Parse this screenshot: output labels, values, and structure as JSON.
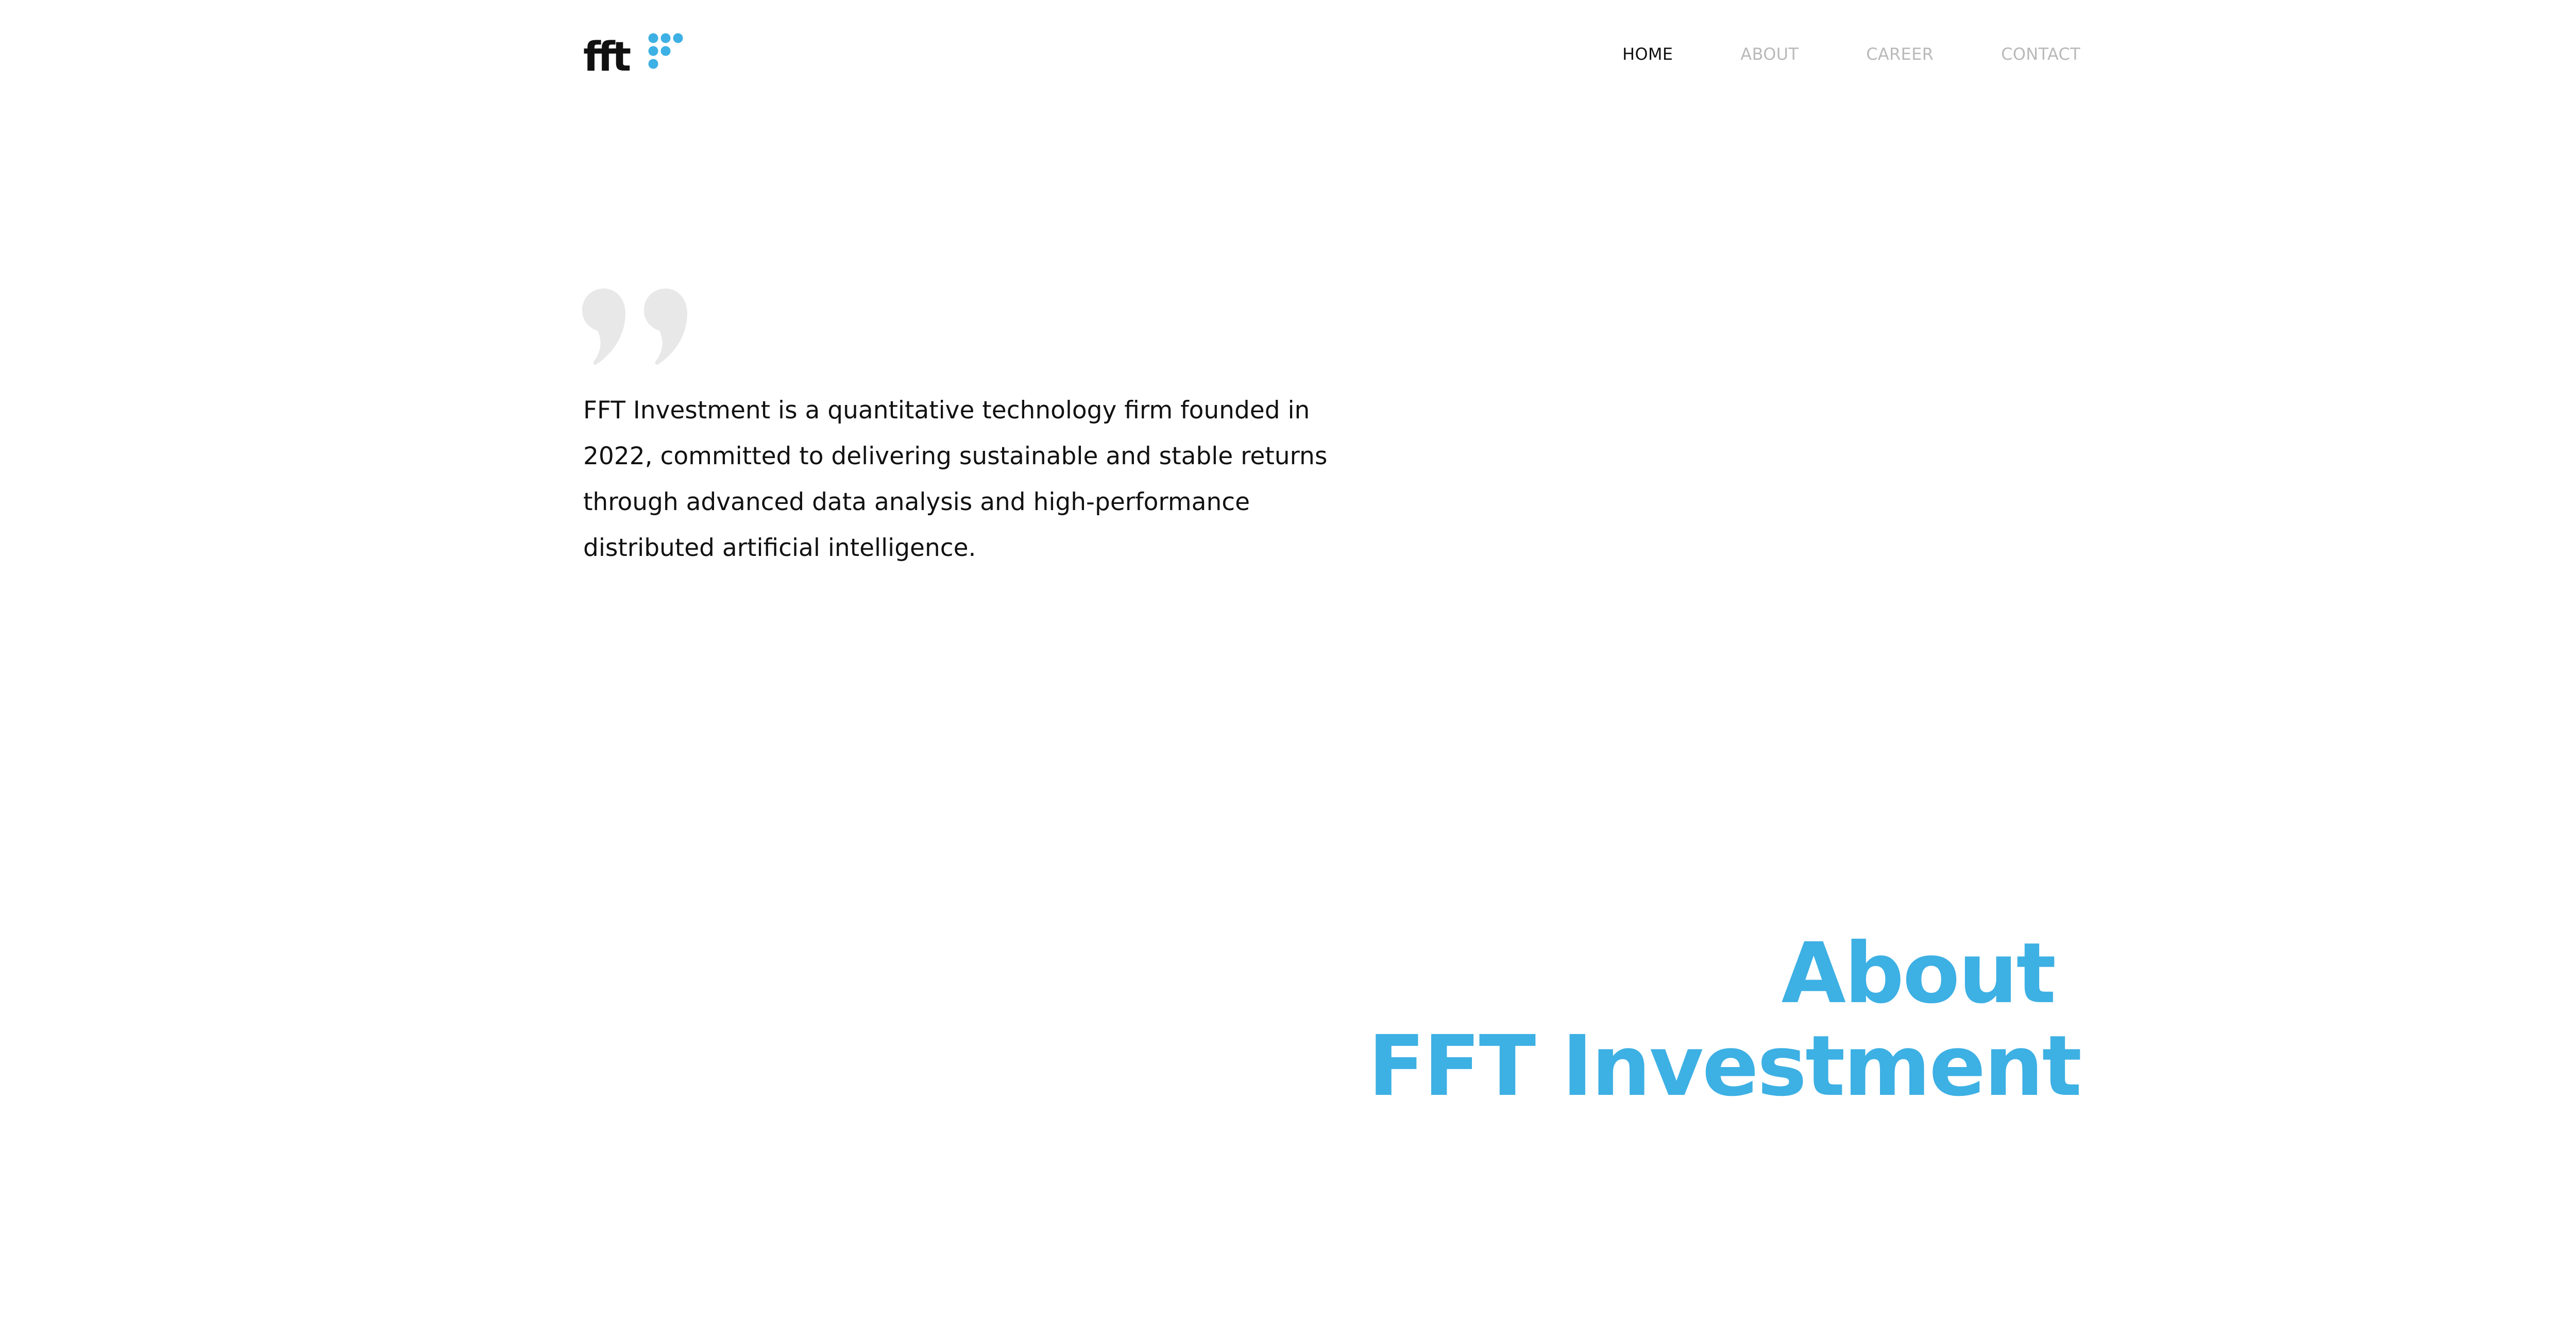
{
  "brand": {
    "logo_text": "fft",
    "accent_color": "#3db0e4",
    "text_color": "#111111"
  },
  "nav": {
    "items": [
      {
        "label": "HOME",
        "active": true
      },
      {
        "label": "ABOUT",
        "active": false
      },
      {
        "label": "CAREER",
        "active": false
      },
      {
        "label": "CONTACT",
        "active": false
      }
    ]
  },
  "intro": {
    "quote_icon": "quote-icon",
    "text": "FFT Investment is a quantitative technology firm founded in 2022, committed to delivering sustainable and stable returns through advanced data analysis and high-performance distributed artificial intelligence."
  },
  "about": {
    "line1": "About",
    "line2": "FFT Investment"
  }
}
